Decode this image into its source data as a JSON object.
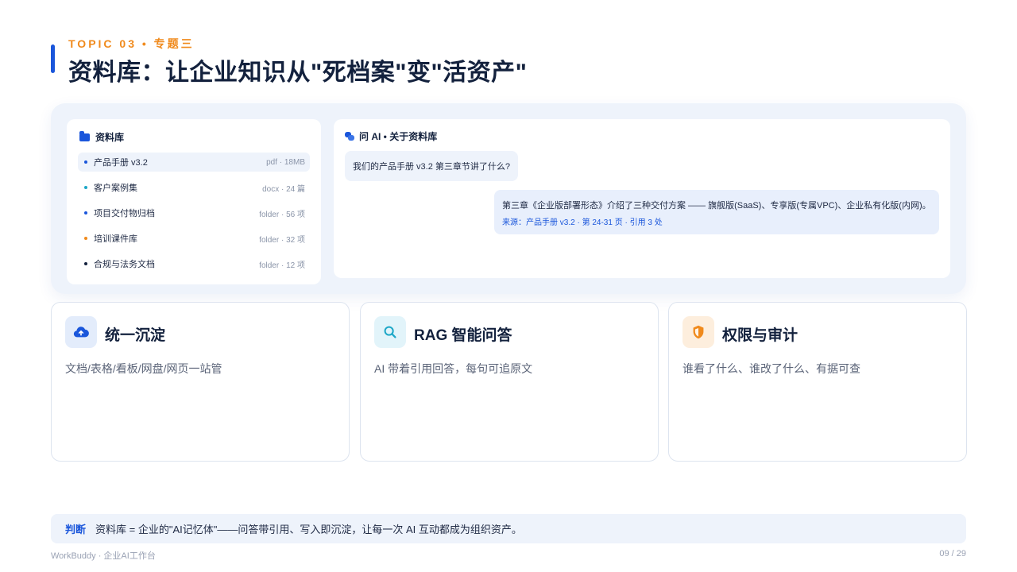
{
  "header": {
    "topic": "TOPIC 03 • 专题三",
    "title": "资料库：让企业知识从\"死档案\"变\"活资产\""
  },
  "library": {
    "title": "资料库",
    "items": [
      {
        "name": "产品手册 v3.2",
        "meta": "pdf · 18MB",
        "color": "#1a56db",
        "active": true
      },
      {
        "name": "客户案例集",
        "meta": "docx · 24 篇",
        "color": "#1ca7c7"
      },
      {
        "name": "项目交付物归档",
        "meta": "folder · 56 项",
        "color": "#1a56db"
      },
      {
        "name": "培训课件库",
        "meta": "folder · 32 项",
        "color": "#f08a1c"
      },
      {
        "name": "合规与法务文档",
        "meta": "folder · 12 项",
        "color": "#13213d"
      }
    ]
  },
  "chat": {
    "title": "问 AI • 关于资料库",
    "question": "我们的产品手册 v3.2 第三章节讲了什么?",
    "answer": "第三章《企业版部署形态》介绍了三种交付方案 —— 旗舰版(SaaS)、专享版(专属VPC)、企业私有化版(内网)。",
    "source": "来源：产品手册 v3.2 · 第 24-31 页 · 引用 3 处"
  },
  "features": [
    {
      "title": "统一沉淀",
      "desc": "文档/表格/看板/网盘/网页一站管",
      "icon": "cloud-upload-icon",
      "icon_bg": "#e3ecfb",
      "icon_color": "#1a56db"
    },
    {
      "title": "RAG 智能问答",
      "desc": "AI 带着引用回答，每句可追原文",
      "icon": "search-icon",
      "icon_bg": "#e2f4fa",
      "icon_color": "#1ca7c7"
    },
    {
      "title": "权限与审计",
      "desc": "谁看了什么、谁改了什么、有据可查",
      "icon": "shield-icon",
      "icon_bg": "#fdeedd",
      "icon_color": "#f08a1c"
    }
  ],
  "verdict": {
    "tag": "判断",
    "text": "资料库 = 企业的\"AI记忆体\"——问答带引用、写入即沉淀，让每一次 AI 互动都成为组织资产。"
  },
  "footer": {
    "left": "WorkBuddy · 企业AI工作台",
    "page": "09 / 29"
  }
}
